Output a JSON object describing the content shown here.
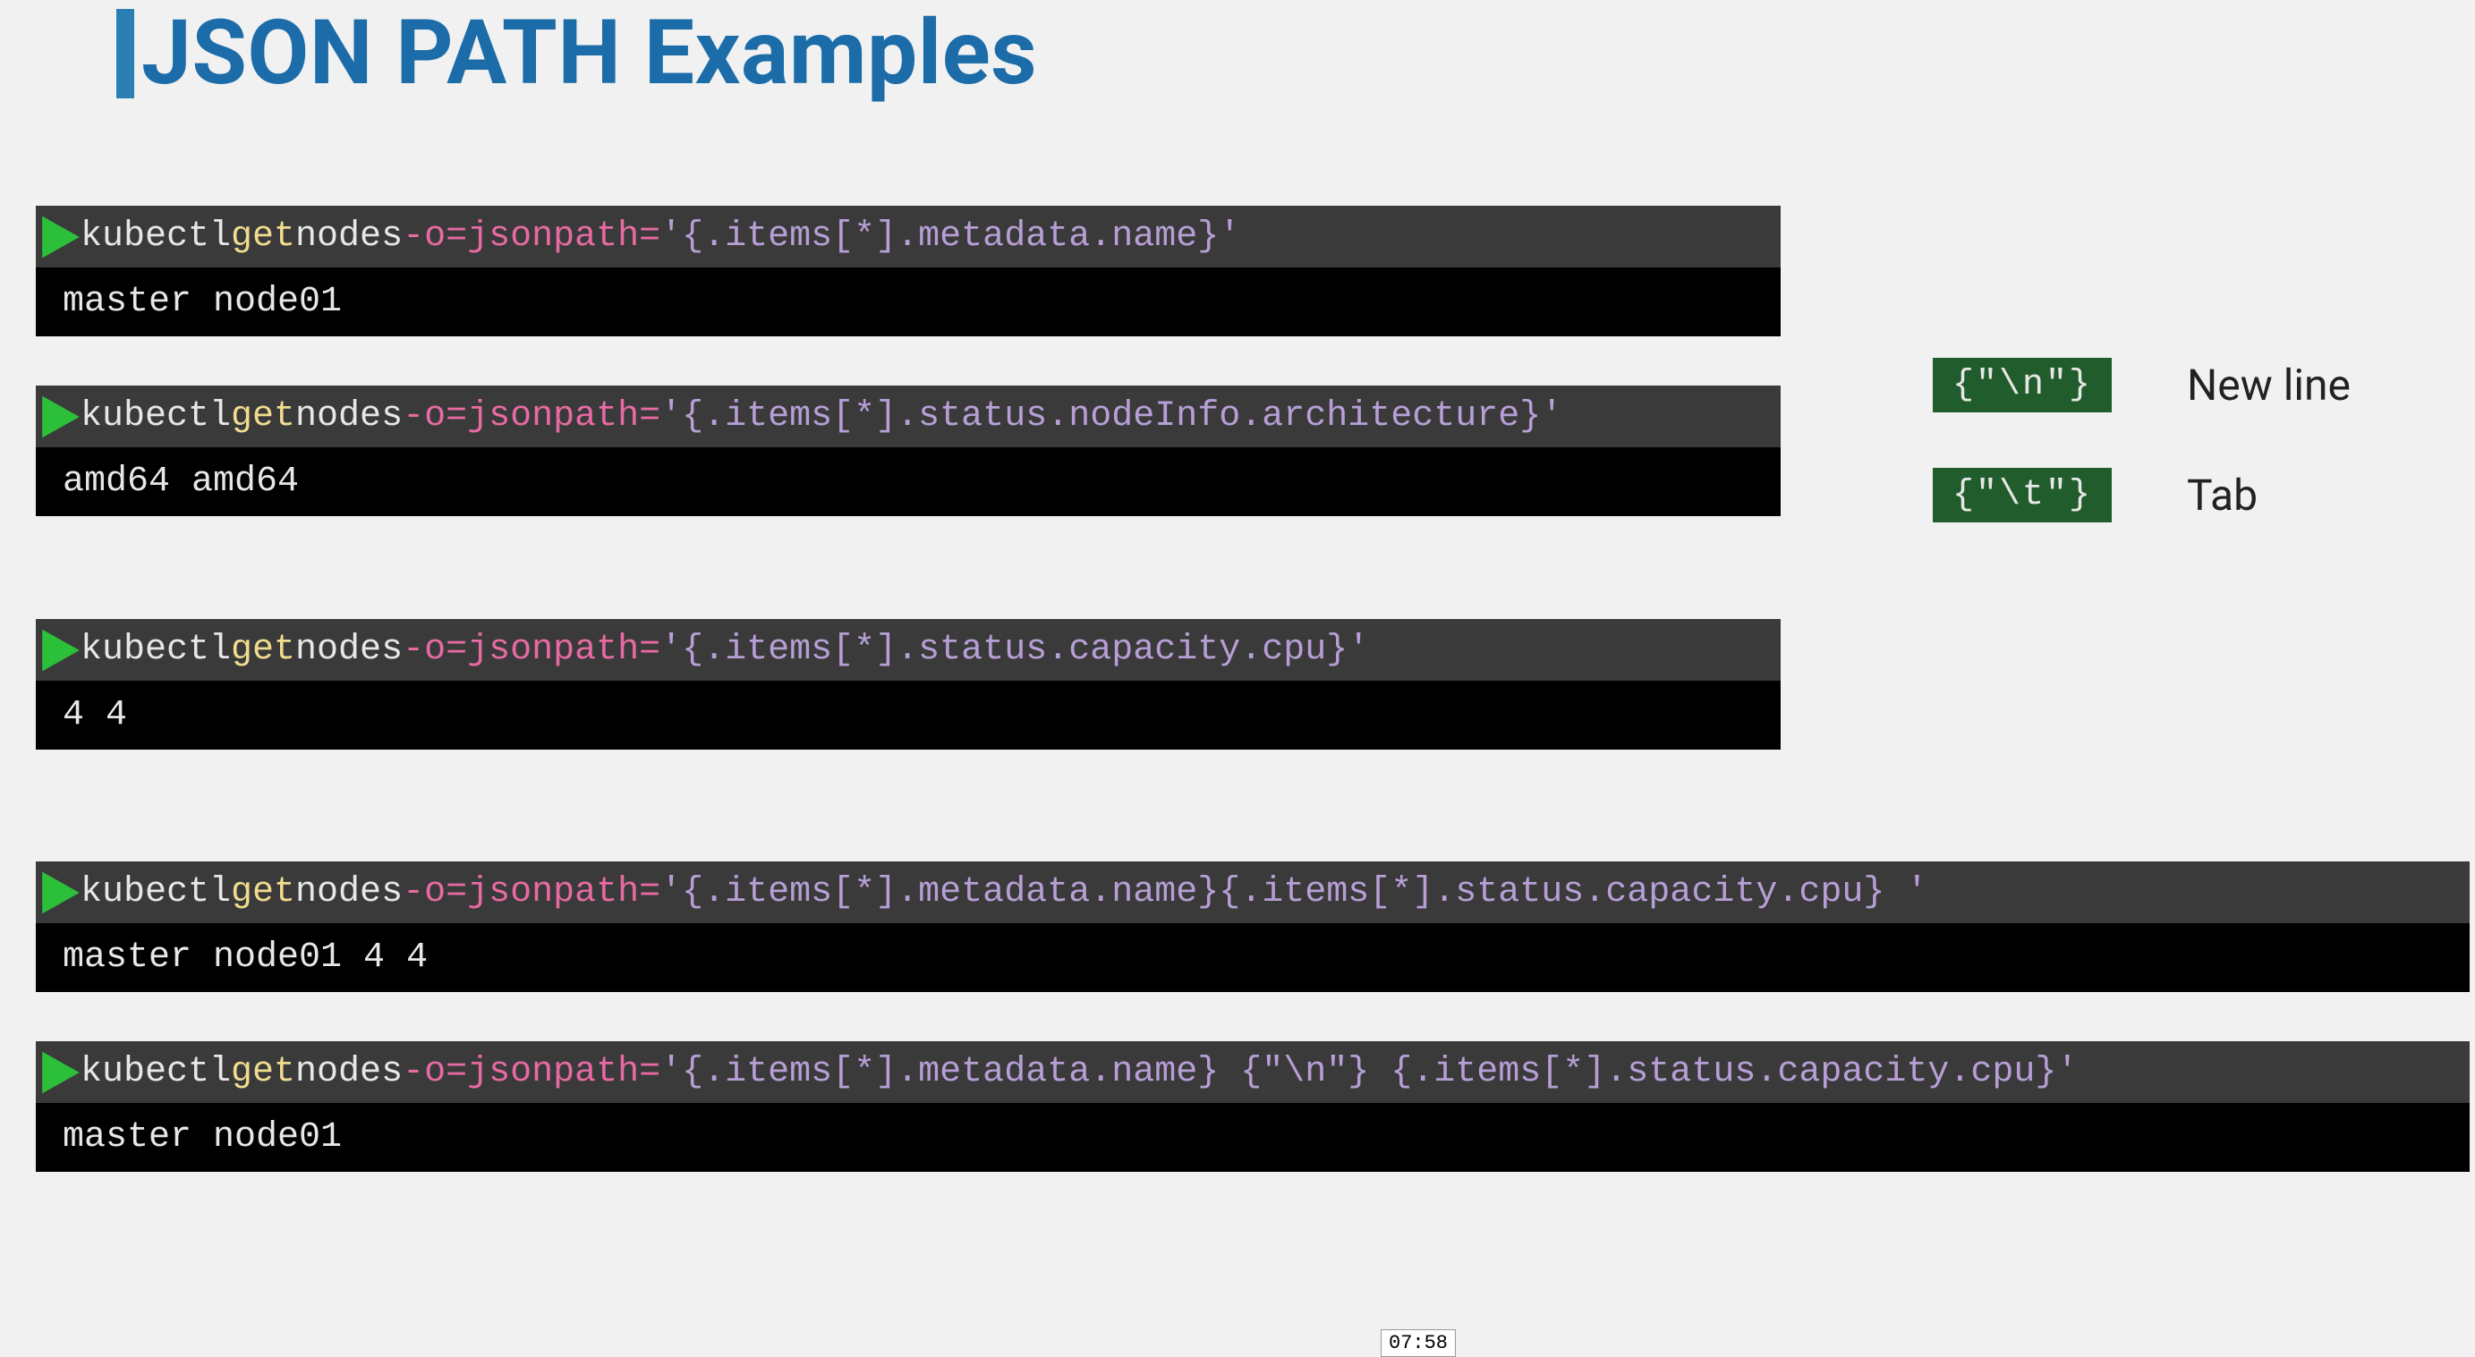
{
  "title": "JSON PATH Examples",
  "legend": {
    "newline": {
      "badge": "{\"\\n\"}",
      "label": "New line"
    },
    "tab": {
      "badge": "{\"\\t\"}",
      "label": "Tab"
    }
  },
  "examples": [
    {
      "cmd": {
        "white1": "kubectl",
        "yellow": " get ",
        "white2": "nodes ",
        "pink": "-o=jsonpath=",
        "lav": "'{.items[*].metadata.name}'"
      },
      "out": "master node01"
    },
    {
      "cmd": {
        "white1": "kubectl",
        "yellow": " get ",
        "white2": "nodes ",
        "pink": "-o=jsonpath=",
        "lav": "'{.items[*].status.nodeInfo.architecture}'"
      },
      "out": "amd64 amd64"
    },
    {
      "cmd": {
        "white1": "kubectl",
        "yellow": " get ",
        "white2": "nodes ",
        "pink": "-o=jsonpath=",
        "lav": "'{.items[*].status.capacity.cpu}'"
      },
      "out": "4 4"
    },
    {
      "cmd": {
        "white1": "kubectl",
        "yellow": " get ",
        "white2": "nodes ",
        "pink": "-o=jsonpath=",
        "lav": "'{.items[*].metadata.name}{.items[*].status.capacity.cpu}    '"
      },
      "out": "master node01 4 4"
    },
    {
      "cmd": {
        "white1": "kubectl",
        "yellow": " get ",
        "white2": "nodes ",
        "pink": "-o=jsonpath=",
        "lav": "'{.items[*].metadata.name} {\"\\n\"} {.items[*].status.capacity.cpu}'"
      },
      "out": "master node01"
    }
  ],
  "timer": "07:58"
}
